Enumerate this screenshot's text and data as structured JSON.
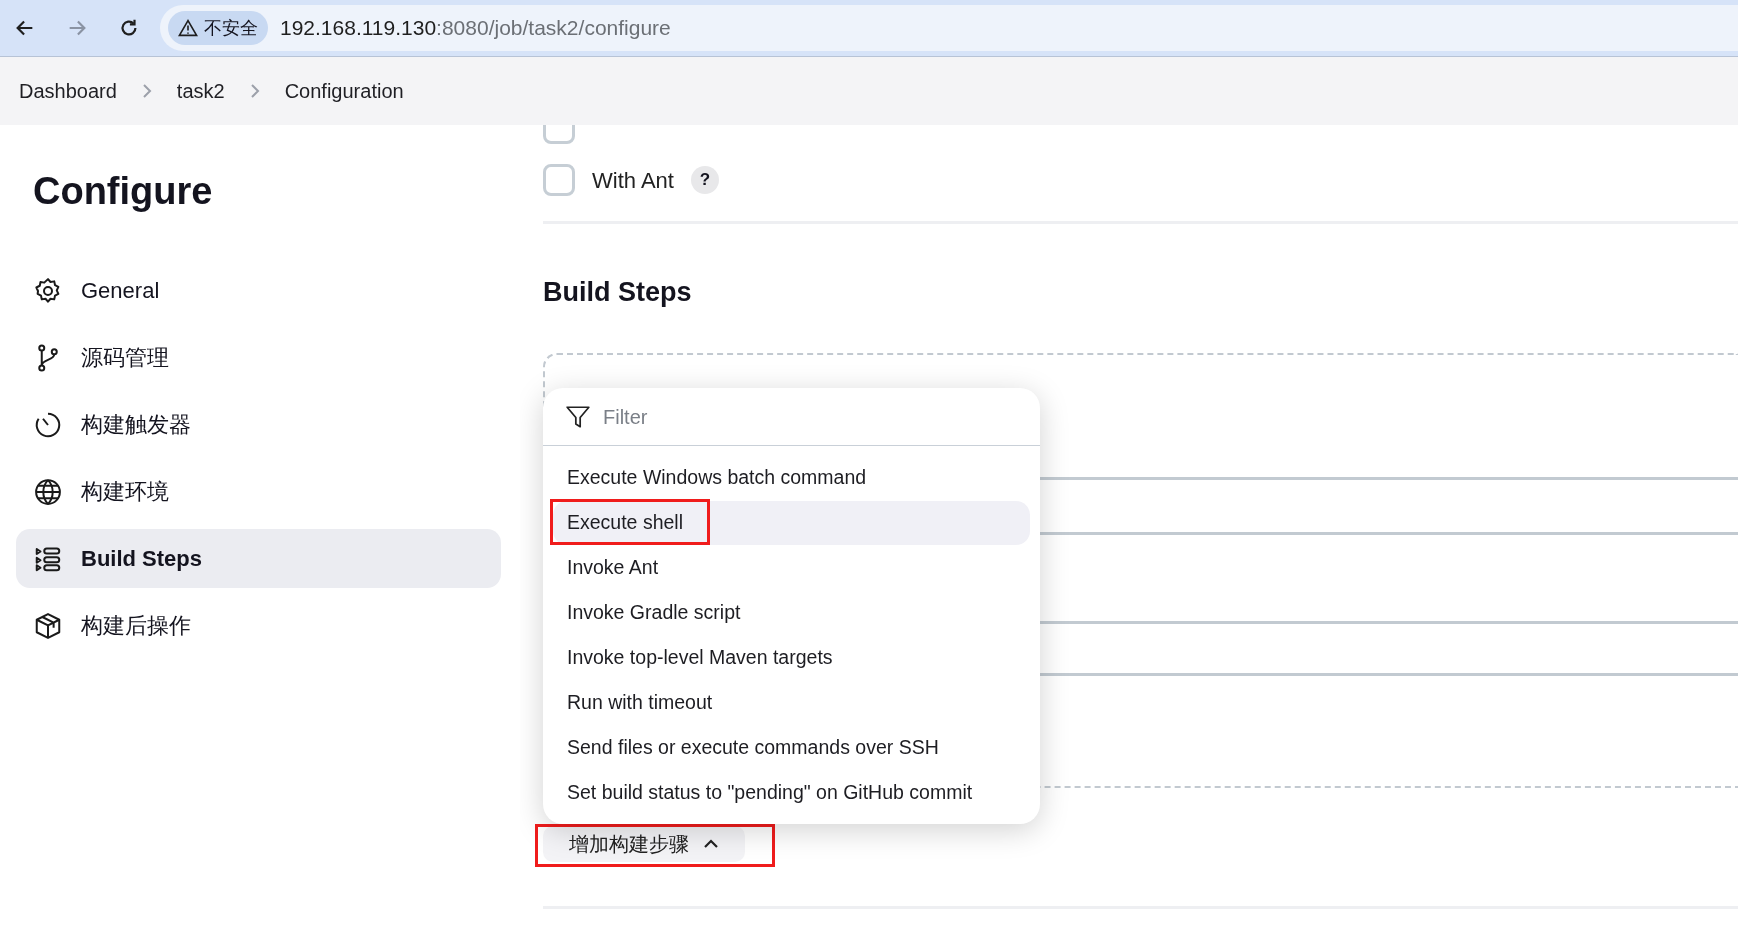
{
  "browser": {
    "security_label": "不安全",
    "url_host": "192.168.119.130",
    "url_path": ":8080/job/task2/configure"
  },
  "breadcrumbs": [
    "Dashboard",
    "task2",
    "Configuration"
  ],
  "sidebar": {
    "title": "Configure",
    "items": [
      {
        "label": "General",
        "selected": false
      },
      {
        "label": "源码管理",
        "selected": false
      },
      {
        "label": "构建触发器",
        "selected": false
      },
      {
        "label": "构建环境",
        "selected": false
      },
      {
        "label": "Build Steps",
        "selected": true
      },
      {
        "label": "构建后操作",
        "selected": false
      }
    ]
  },
  "options": [
    {
      "checked": false
    },
    {
      "label": "With Ant",
      "checked": false,
      "help": "?"
    }
  ],
  "section_title": "Build Steps",
  "menu": {
    "placeholder": "Filter",
    "items": [
      {
        "label": "Execute Windows batch command",
        "hovered": false,
        "annotated": false
      },
      {
        "label": "Execute shell",
        "hovered": true,
        "annotated": true
      },
      {
        "label": "Invoke Ant",
        "hovered": false,
        "annotated": false
      },
      {
        "label": "Invoke Gradle script",
        "hovered": false,
        "annotated": false
      },
      {
        "label": "Invoke top-level Maven targets",
        "hovered": false,
        "annotated": false
      },
      {
        "label": "Run with timeout",
        "hovered": false,
        "annotated": false
      },
      {
        "label": "Send files or execute commands over SSH",
        "hovered": false,
        "annotated": false
      },
      {
        "label": "Set build status to \"pending\" on GitHub commit",
        "hovered": false,
        "annotated": false
      }
    ]
  },
  "add_button": {
    "label": "增加构建步骤",
    "expanded": true,
    "annotated": true
  }
}
